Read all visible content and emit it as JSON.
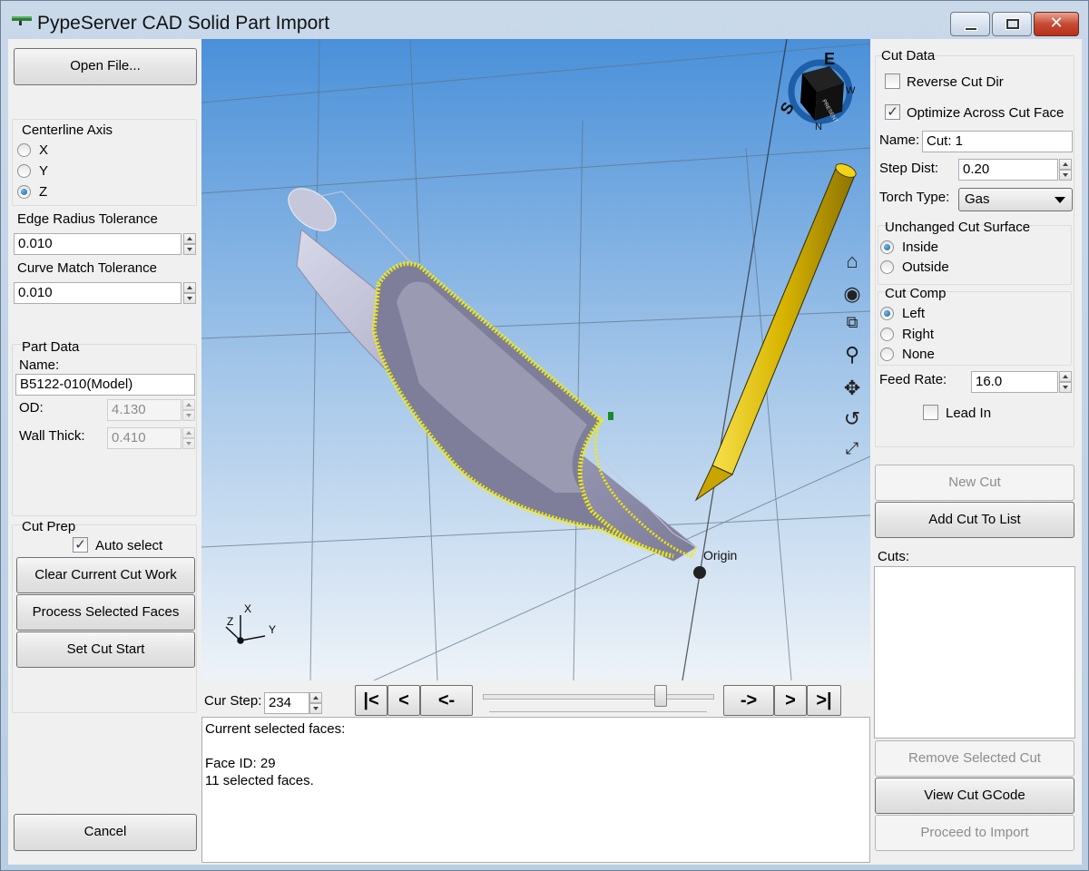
{
  "window": {
    "title": "PypeServer CAD Solid Part Import",
    "controls": {
      "minimize": "–",
      "maximize": "□",
      "close": "✕"
    }
  },
  "left_panel": {
    "open_file": "Open File...",
    "centerline_axis": {
      "label": "Centerline Axis",
      "options": [
        "X",
        "Y",
        "Z"
      ],
      "selected": "Z"
    },
    "edge_radius_tolerance": {
      "label": "Edge Radius Tolerance",
      "value": "0.010"
    },
    "curve_match_tolerance": {
      "label": "Curve Match Tolerance",
      "value": "0.010"
    },
    "part_data": {
      "label": "Part Data",
      "name_label": "Name:",
      "name_value": "B5122-010(Model)",
      "od_label": "OD:",
      "od_value": "4.130",
      "wall_label": "Wall Thick:",
      "wall_value": "0.410"
    },
    "cut_prep": {
      "label": "Cut Prep",
      "auto_select_label": "Auto select",
      "auto_select_checked": true,
      "clear_current": "Clear Current Cut Work",
      "process_selected": "Process Selected Faces",
      "set_cut_start": "Set Cut Start"
    },
    "cancel": "Cancel"
  },
  "viewport": {
    "origin_label": "Origin",
    "triad": {
      "x": "X",
      "y": "Y",
      "z": "Z"
    },
    "viewcube": {
      "n": "N",
      "e": "E",
      "s": "S",
      "w": "W",
      "face": "PRESENT"
    },
    "toolbar_icons": [
      "home-icon",
      "eye-icon",
      "zoom-window-icon",
      "zoom-icon",
      "pan-icon",
      "rotate-icon",
      "fit-icon"
    ]
  },
  "step_bar": {
    "cur_step_label": "Cur Step:",
    "cur_step_value": "234",
    "first": "|<",
    "prev": "<",
    "back": "<-",
    "forward": "->",
    "next": ">",
    "last": ">|",
    "slider_fraction": 0.77
  },
  "output": {
    "line1": "Current selected faces:",
    "line2": "Face ID: 29",
    "line3": "11 selected faces."
  },
  "right_panel": {
    "cut_data_label": "Cut Data",
    "reverse_cut_dir": {
      "label": "Reverse Cut Dir",
      "checked": false
    },
    "optimize": {
      "label": "Optimize Across Cut Face",
      "checked": true
    },
    "name": {
      "label": "Name:",
      "value": "Cut: 1"
    },
    "step_dist": {
      "label": "Step Dist:",
      "value": "0.20"
    },
    "torch_type": {
      "label": "Torch Type:",
      "value": "Gas"
    },
    "unchanged_surface": {
      "label": "Unchanged Cut Surface",
      "options": [
        "Inside",
        "Outside"
      ],
      "selected": "Inside"
    },
    "cut_comp": {
      "label": "Cut Comp",
      "options": [
        "Left",
        "Right",
        "None"
      ],
      "selected": "Left"
    },
    "feed_rate": {
      "label": "Feed Rate:",
      "value": "16.0"
    },
    "lead_in": {
      "label": "Lead In",
      "checked": false
    },
    "new_cut": "New Cut",
    "add_cut": "Add Cut To List",
    "cuts_label": "Cuts:",
    "remove_selected": "Remove Selected Cut",
    "view_gcode": "View Cut GCode",
    "proceed": "Proceed to Import"
  },
  "colors": {
    "viewport_top": "#4a90d9",
    "viewport_bottom": "#eef3f8",
    "tube": "#9b9bb8",
    "torch": "#e6c100",
    "highlight": "#f5f000"
  }
}
